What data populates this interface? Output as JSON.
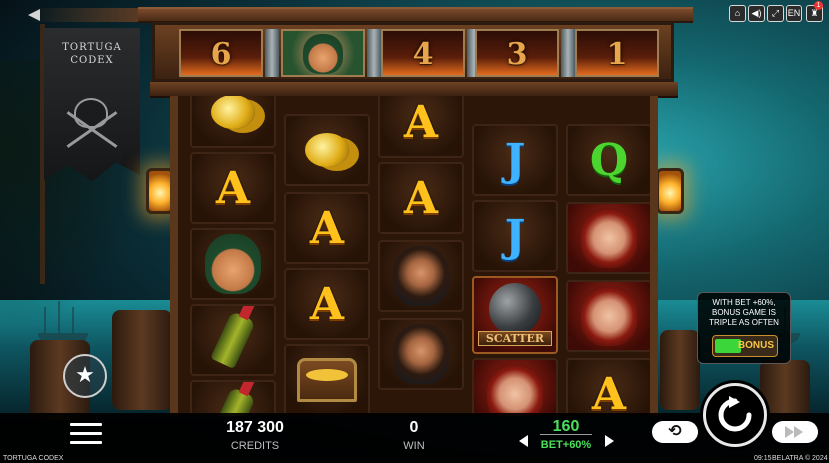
{
  "game": {
    "title": "TORTUGA CODEX",
    "flag_title_line1": "TORTUGA",
    "flag_title_line2": "CODEX",
    "language": "EN",
    "notification_count": "1"
  },
  "multipliers": [
    "6",
    "",
    "4",
    "3",
    "1"
  ],
  "reels": [
    [
      "coin",
      "A",
      "pirate1",
      "bottle",
      "bottle"
    ],
    [
      "coin",
      "A",
      "A",
      "chest"
    ],
    [
      "A",
      "A",
      "bearded-pirate",
      "bearded-pirate"
    ],
    [
      "J",
      "J",
      "scatter",
      "lady"
    ],
    [
      "Q",
      "lady",
      "lady",
      "A"
    ]
  ],
  "scatter_label": "SCATTER",
  "promo": {
    "text_line1": "WITH BET +60%,",
    "text_line2": "BONUS GAME IS",
    "text_line3": "TRIPLE AS OFTEN",
    "button_label": "BONUS"
  },
  "bottom": {
    "credits_value": "187 300",
    "credits_label": "CREDITS",
    "win_value": "0",
    "win_label": "WIN",
    "bet_value": "160",
    "bet_label": "BET+60%"
  },
  "footer": {
    "title": "TORTUGA CODEX",
    "time": "09:15",
    "copyright": "BELATRA © 2024"
  },
  "colors": {
    "accent_green": "#3ad63a",
    "bet_green": "#4be05b",
    "gold": "#ffc21c"
  }
}
